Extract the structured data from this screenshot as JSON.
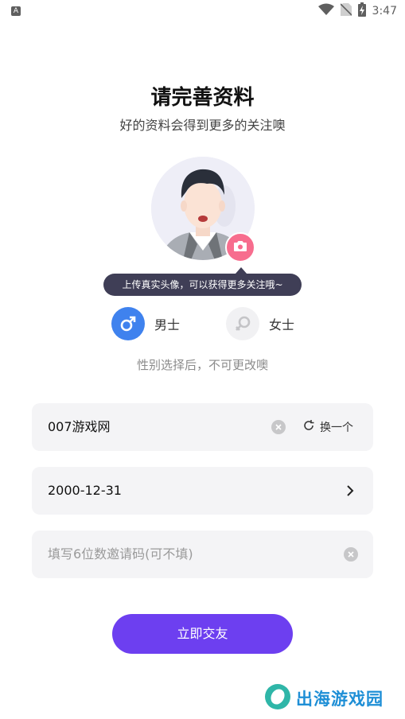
{
  "status_bar": {
    "time": "3:47",
    "left_icon": "A"
  },
  "header": {
    "title": "请完善资料",
    "subtitle": "好的资料会得到更多的关注噢"
  },
  "avatar": {
    "tooltip": "上传真实头像，可以获得更多关注哦~"
  },
  "gender": {
    "male_label": "男士",
    "female_label": "女士",
    "selected": "male",
    "note": "性别选择后，不可更改噢"
  },
  "form": {
    "nickname_value": "007游戏网",
    "refresh_label": "换一个",
    "birthday_value": "2000-12-31",
    "invite_placeholder": "填写6位数邀请码(可不填)"
  },
  "submit_label": "立即交友",
  "watermark_text": "出海游戏园",
  "colors": {
    "primary": "#6d3ff0",
    "male": "#3f82ee",
    "camera": "#f76d8e",
    "tooltip": "#3f3e56"
  },
  "icons": [
    "wifi-icon",
    "sim-off-icon",
    "battery-charging-icon",
    "camera-icon",
    "male-icon",
    "female-icon",
    "clear-icon",
    "refresh-icon",
    "chevron-right-icon"
  ]
}
